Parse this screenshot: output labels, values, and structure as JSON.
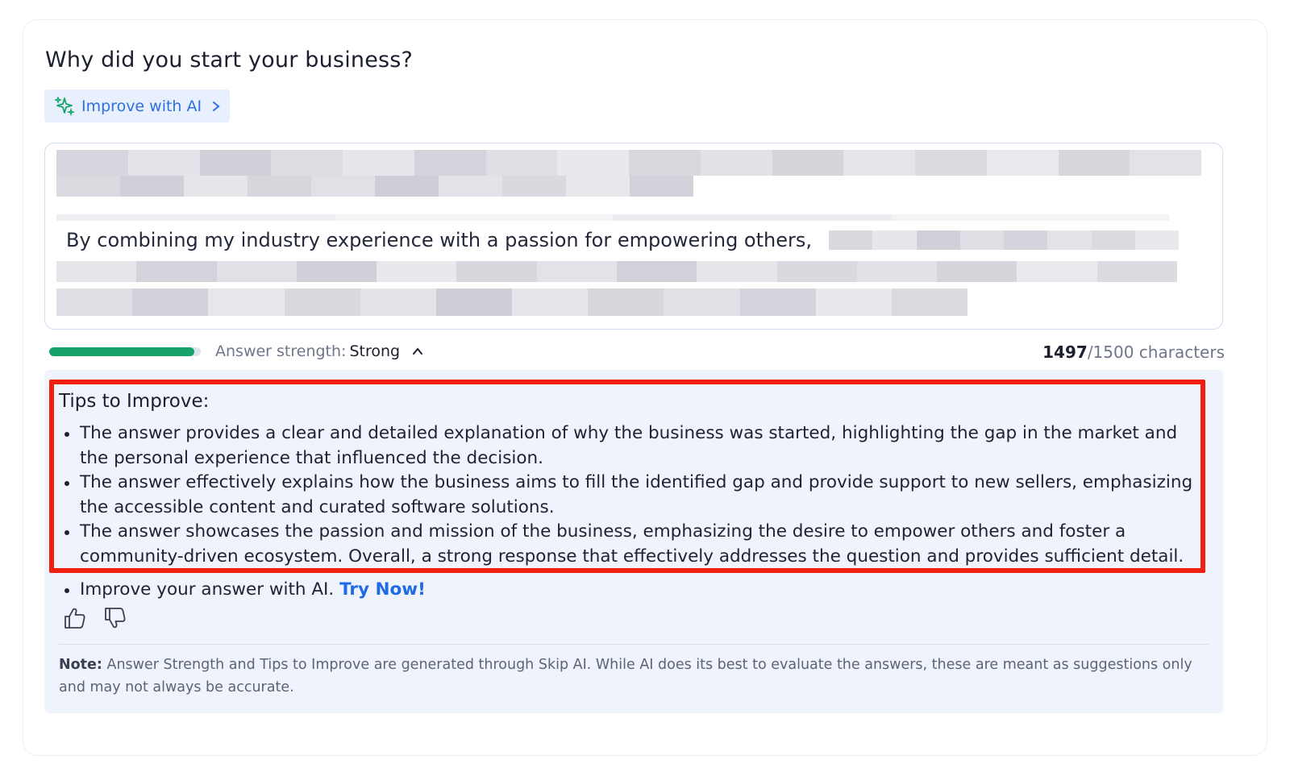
{
  "question": {
    "title": "Why did you start your business?"
  },
  "ai_button": {
    "label": "Improve with AI",
    "icon": "sparkle-icon"
  },
  "answer": {
    "visible_text": "By combining my industry experience with a passion for empowering others,",
    "redacted": true
  },
  "strength": {
    "label": "Answer strength:",
    "value": "Strong",
    "fill_fraction": 0.96,
    "bar_color": "#15a36a"
  },
  "char_count": {
    "current": "1497",
    "limit": "/1500 characters"
  },
  "tips": {
    "title": "Tips to Improve:",
    "items": [
      "The answer provides a clear and detailed explanation of why the business was started, highlighting the gap in the market and the personal experience that influenced the decision.",
      "The answer effectively explains how the business aims to fill the identified gap and provide support to new sellers, emphasizing the accessible content and curated software solutions.",
      "The answer showcases the passion and mission of the business, emphasizing the desire to empower others and foster a community-driven ecosystem. Overall, a strong response that effectively addresses the question and provides sufficient detail."
    ],
    "ai_prompt": "Improve your answer with AI.",
    "ai_link": "Try Now!"
  },
  "note": {
    "label": "Note:",
    "text": "Answer Strength and Tips to Improve are generated through Skip AI. While AI does its best to evaluate the answers, these are meant as suggestions only and may not always be accurate."
  },
  "colors": {
    "accent": "#2f6fe0",
    "link": "#1f6ae6",
    "highlight": "#f01f0f",
    "panel": "#eff3fb"
  }
}
